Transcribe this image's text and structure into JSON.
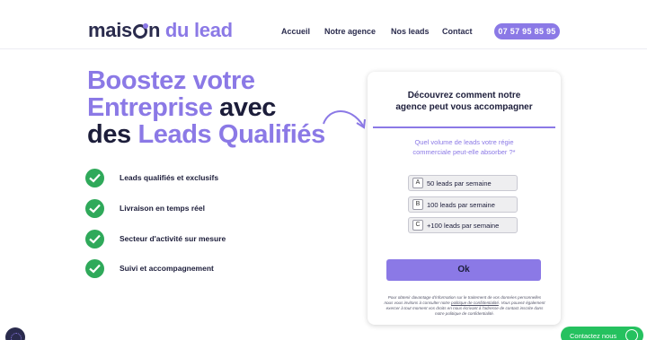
{
  "header": {
    "logo": {
      "part1": "mais",
      "part2": "n",
      "part3": "du lead"
    },
    "nav": [
      "Accueil",
      "Notre agence",
      "Nos leads",
      "Contact"
    ],
    "phone": "07 57 95 85 95"
  },
  "hero": {
    "line1": "Boostez votre",
    "line2_accent": "Entreprise",
    "line2_rest": "avec",
    "line3_start": "des",
    "line3_accent": "Leads Qualifiés"
  },
  "features": [
    "Leads qualifiés et exclusifs",
    "Livraison en temps réel",
    "Secteur d'activité sur mesure",
    "Suivi et accompagnement"
  ],
  "form": {
    "title_line1": "Découvrez comment notre",
    "title_line2": "agence peut vous accompagner",
    "question_line1": "Quel volume de leads votre régie",
    "question_line2": "commerciale peut-elle absorber ?*",
    "options": [
      {
        "key": "A",
        "label": "50 leads par semaine"
      },
      {
        "key": "B",
        "label": "100 leads par semaine"
      },
      {
        "key": "C",
        "label": "+100 leads par semaine"
      }
    ],
    "submit": "Ok",
    "disclaimer_part1": "Pour obtenir davantage d'information sur le traitement de vos données personnelles nous vous invitons à consulter notre",
    "disclaimer_link": "politique de confidentialité",
    "disclaimer_part2": ". Vous pouvez également exercer à tout moment vos droits en nous écrivant à l'adresse de contact inscrite dans notre politique de confidentialité."
  },
  "whatsapp": {
    "label": "Contactez nous"
  },
  "colors": {
    "accent": "#8b79e6",
    "dark": "#1c1d3a",
    "check": "#2fa95a",
    "whatsapp": "#25c15f"
  }
}
